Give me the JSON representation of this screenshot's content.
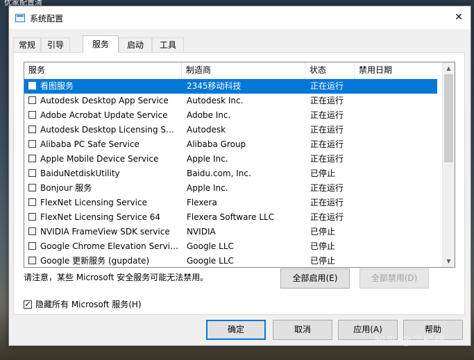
{
  "desktop": {
    "partial_label": "优家配置清",
    "watermark": "知乎 @吴師傅"
  },
  "window": {
    "title": "系统配置",
    "close_glyph": "✕"
  },
  "tabs": [
    {
      "label": "常规",
      "active": false
    },
    {
      "label": "引导",
      "active": false
    },
    {
      "label": "服务",
      "active": true
    },
    {
      "label": "启动",
      "active": false
    },
    {
      "label": "工具",
      "active": false
    }
  ],
  "services": {
    "columns": [
      "服务",
      "制造商",
      "状态",
      "禁用日期"
    ],
    "rows": [
      {
        "name": "看图服务",
        "vendor": "2345移动科技",
        "status": "正在运行",
        "date": "",
        "checked": false,
        "selected": true
      },
      {
        "name": "Autodesk Desktop App Service",
        "vendor": "Autodesk Inc.",
        "status": "正在运行",
        "date": "",
        "checked": false,
        "selected": false
      },
      {
        "name": "Adobe Acrobat Update Service",
        "vendor": "Adobe Inc.",
        "status": "正在运行",
        "date": "",
        "checked": false,
        "selected": false
      },
      {
        "name": "Autodesk Desktop Licensing Ser...",
        "vendor": "Autodesk",
        "status": "正在运行",
        "date": "",
        "checked": false,
        "selected": false
      },
      {
        "name": "Alibaba PC Safe Service",
        "vendor": "Alibaba Group",
        "status": "正在运行",
        "date": "",
        "checked": false,
        "selected": false
      },
      {
        "name": "Apple Mobile Device Service",
        "vendor": "Apple Inc.",
        "status": "正在运行",
        "date": "",
        "checked": false,
        "selected": false
      },
      {
        "name": "BaiduNetdiskUtility",
        "vendor": "Baidu.com, Inc.",
        "status": "已停止",
        "date": "",
        "checked": false,
        "selected": false
      },
      {
        "name": "Bonjour 服务",
        "vendor": "Apple Inc.",
        "status": "正在运行",
        "date": "",
        "checked": false,
        "selected": false
      },
      {
        "name": "FlexNet Licensing Service",
        "vendor": "Flexera",
        "status": "正在运行",
        "date": "",
        "checked": false,
        "selected": false
      },
      {
        "name": "FlexNet Licensing Service 64",
        "vendor": "Flexera Software LLC",
        "status": "正在运行",
        "date": "",
        "checked": false,
        "selected": false
      },
      {
        "name": "NVIDIA FrameView SDK service",
        "vendor": "NVIDIA",
        "status": "已停止",
        "date": "",
        "checked": false,
        "selected": false
      },
      {
        "name": "Google Chrome Elevation Servic...",
        "vendor": "Google LLC",
        "status": "已停止",
        "date": "",
        "checked": false,
        "selected": false
      },
      {
        "name": "Google 更新服务 (gupdate)",
        "vendor": "Google LLC",
        "status": "已停止",
        "date": "",
        "checked": false,
        "selected": false
      }
    ],
    "scroll_up_glyph": "▲",
    "scroll_down_glyph": "▼"
  },
  "note": "请注意，某些 Microsoft 安全服务可能无法禁用。",
  "buttons": {
    "enable_all": "全部启用(E)",
    "disable_all": "全部禁用(D)",
    "ok": "确定",
    "cancel": "取消",
    "apply": "应用(A)",
    "help": "帮助"
  },
  "hide_ms": {
    "label": "隐藏所有 Microsoft 服务(H)",
    "checked": true,
    "check_glyph": "✓"
  },
  "colors": {
    "selection": "#0078d7",
    "window_bg": "#f0f0f0"
  }
}
